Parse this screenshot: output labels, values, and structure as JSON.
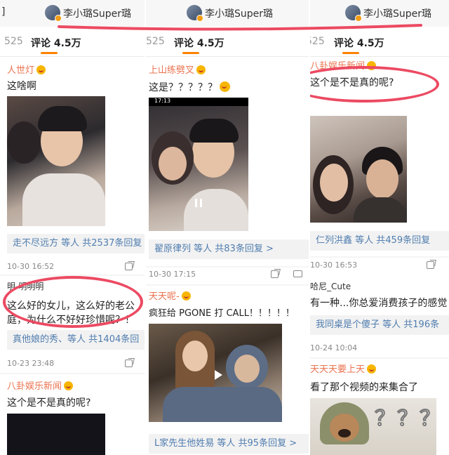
{
  "header": {
    "account_name": "李小璐Super璐",
    "left_fragment": "]"
  },
  "tabs": {
    "count_fragment": "525",
    "comments_label": "评论 4.5万"
  },
  "col1": {
    "c1_user": "人世灯",
    "c1_text": "这啥啊",
    "reply1_names": "走不尽远方 等人",
    "reply1_count": "共2537条回复",
    "ts1": "10-30 16:52",
    "c2_user": "明-明明明",
    "c2_line1": "这么好的女儿，这么好的老公",
    "c2_line2": "庭，为什么不好好珍惜呢？！",
    "reply2_names": "真他娘的秀、等人",
    "reply2_count": "共1404条回",
    "ts2": "10-23 23:48",
    "c3_user": "八卦娱乐新闻",
    "c3_text": "这个是不是真的呢?"
  },
  "col2": {
    "c1_user": "上山练劈叉",
    "c1_text": "这是？？？？？",
    "video_time": "17:13",
    "reply1_names": "翟原律列 等人",
    "reply1_count": "共83条回复 >",
    "ts1": "10-30 17:15",
    "c2_user": "天天呢-",
    "c2_text": "疯狂给 PGONE 打 CALL！！！！！",
    "reply2_names": "L家先生他姓易 等人",
    "reply2_count": "共95条回复 >"
  },
  "col3": {
    "c1_user": "八卦娱乐新闻",
    "c1_text": "这个是不是真的呢?",
    "reply1_names": "仁列洪鑫 等人",
    "reply1_count": "共459条回复",
    "ts1": "10-30 16:53",
    "c2_user": "哈尼_Cute",
    "c2_text": "有一种...你总爱消费孩子的感觉",
    "reply2_names": "我同桌是个傻子 等人",
    "reply2_count": "共196条",
    "ts2": "10-24 10:04",
    "c3_user": "天天天要上天",
    "c3_text": "看了那个视频的来集合了",
    "meme_text": "？？？"
  },
  "colors": {
    "accent": "#ff8200",
    "username": "#eb7350",
    "link": "#507daf",
    "highlight": "#ec4a62"
  }
}
